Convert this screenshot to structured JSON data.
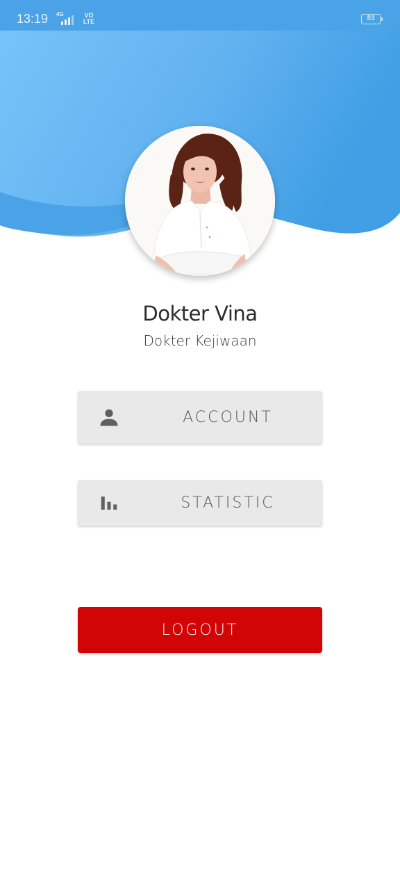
{
  "status_bar": {
    "time": "13:19",
    "network": "4G",
    "volte_top": "VO",
    "volte_bottom": "LTE",
    "battery": "83"
  },
  "colors": {
    "header_light": "#72bff6",
    "header_dark": "#3f9ee4",
    "logout": "#d10505",
    "menu_bg": "#e9e9e9"
  },
  "profile": {
    "avatar": "doctor-photo",
    "name": "Dokter Vina",
    "role": "Dokter Kejiwaan"
  },
  "menu": {
    "account": {
      "label": "ACCOUNT",
      "icon": "person-icon"
    },
    "statistic": {
      "label": "STATISTIC",
      "icon": "bar-chart-icon"
    }
  },
  "logout": {
    "label": "LOGOUT"
  }
}
